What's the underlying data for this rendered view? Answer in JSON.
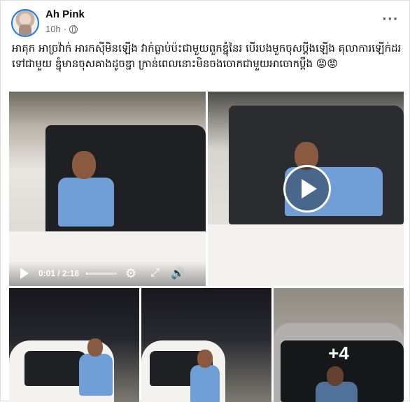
{
  "post": {
    "author_name": "Ah Pink",
    "timestamp": "10h",
    "meta_separator": "·",
    "caption": "អាគុក អាច្រវ៉ាក់ អារកស៊ីមិនឡើង វាក់ធ្លាប់ប៉ះជាមួយពួកឌ្ជុំនៃរ បើរបងមួកចុសប្ដីងឡើង គុលាការឡើក់ដរទៅជាមួយ ឌ្ជុំមានចុសគាងដូចឌ្ជា ក្រាន់ពេលនោះមិនចងចោកជាមួយអាចោកប្ដឹង 😡😡",
    "more_label": "···"
  },
  "video": {
    "current_time": "0:01",
    "duration": "2:18",
    "time_display": "0:01 / 2:18",
    "progress": 0.05
  },
  "gallery": {
    "more_count": "+4"
  },
  "icons": {
    "privacy": "globe-icon",
    "options": "more-options-icon",
    "play": "play-icon",
    "settings": "gear-icon",
    "fullscreen": "expand-icon",
    "volume": "volume-icon"
  },
  "colors": {
    "link_blue": "#1877f2",
    "secondary_text": "#65676b",
    "shirt_blue": "#6f9fd6"
  }
}
